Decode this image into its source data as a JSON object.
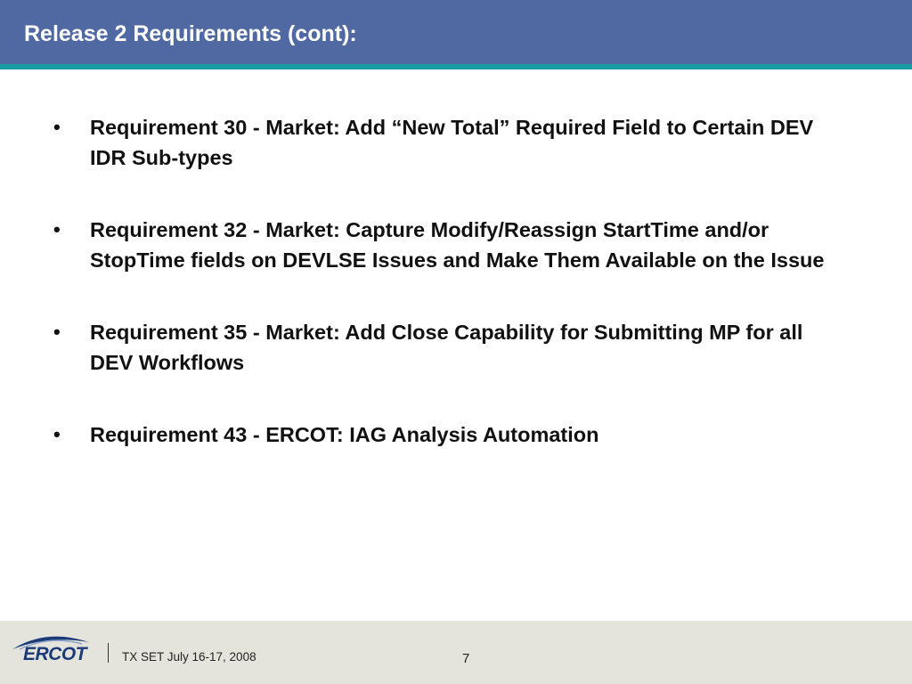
{
  "slide": {
    "title": "Release 2 Requirements (cont):",
    "bullets": [
      "Requirement 30 - Market:  Add “New Total” Required Field to Certain DEV IDR Sub-types",
      "Requirement 32 - Market:  Capture Modify/Reassign StartTime and/or StopTime fields on DEVLSE Issues and Make Them Available on the Issue",
      "Requirement 35 - Market:  Add Close Capability for Submitting MP for all DEV Workflows",
      "Requirement 43 - ERCOT:  IAG Analysis Automation"
    ],
    "bullet_symbol": "•"
  },
  "footer": {
    "logo_text": "ERCOT",
    "event_text": "TX SET July 16-17, 2008",
    "page_number": "7"
  },
  "colors": {
    "header_bg": "#5169a3",
    "header_stripe": "#1a9ca2",
    "footer_bg": "#e5e4dc",
    "logo_blue": "#1b3a78"
  }
}
